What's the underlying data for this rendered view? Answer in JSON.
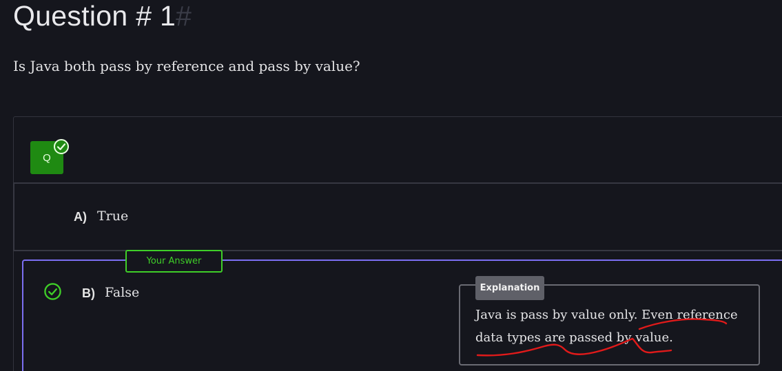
{
  "question": {
    "title": "Question # 1",
    "anchor": "#",
    "text": "Is Java both pass by reference and pass by value?"
  },
  "badge": {
    "label": "Q",
    "icon": "check-circle-icon"
  },
  "options": [
    {
      "letter": "A)",
      "text": "True"
    },
    {
      "letter": "B)",
      "text": "False",
      "icon": "check-circle-icon"
    }
  ],
  "your_answer_label": "Your Answer",
  "explanation": {
    "tag": "Explanation",
    "text": "Java is pass by value only. Even reference data types are passed by value."
  },
  "colors": {
    "background": "#15161d",
    "correct": "#3fcf28",
    "badge": "#1f8a12",
    "selected_border": "#7c6ff2",
    "annotation": "#e11a1a"
  }
}
